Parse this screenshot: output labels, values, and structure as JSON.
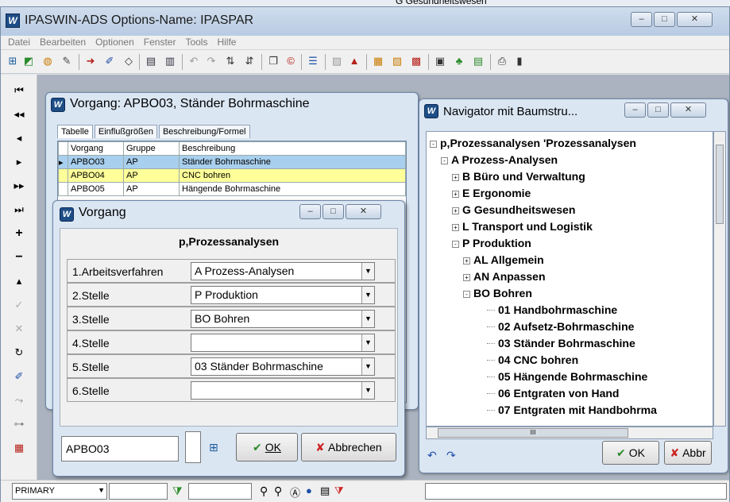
{
  "bg_title": "G Gesundheitswesen",
  "app": {
    "title": "IPASWIN-ADS   Options-Name: IPASPAR",
    "menu": [
      "Datei",
      "Bearbeiten",
      "Optionen",
      "Fenster",
      "Tools",
      "Hilfe"
    ],
    "minimize": "–",
    "maximize": "□",
    "close": "✕"
  },
  "vorgang_window": {
    "title": "Vorgang: APBO03, Ständer Bohrmaschine",
    "tabs": [
      "Tabelle",
      "Einflußgrößen",
      "Beschreibung/Formel"
    ],
    "columns": [
      "Vorgang",
      "Gruppe",
      "Beschreibung"
    ],
    "rows": [
      {
        "vorgang": "APBO03",
        "gruppe": "AP",
        "beschreibung": "Ständer Bohrmaschine"
      },
      {
        "vorgang": "APBO04",
        "gruppe": "AP",
        "beschreibung": "CNC bohren"
      },
      {
        "vorgang": "APBO05",
        "gruppe": "AP",
        "beschreibung": "Hängende Bohrmaschine"
      }
    ]
  },
  "dialog": {
    "title": "Vorgang",
    "heading": "p,Prozessanalysen",
    "fields": [
      {
        "label": "1.Arbeitsverfahren",
        "value": "A Prozess-Analysen"
      },
      {
        "label": "2.Stelle",
        "value": "P Produktion"
      },
      {
        "label": "3.Stelle",
        "value": "BO Bohren"
      },
      {
        "label": "4.Stelle",
        "value": ""
      },
      {
        "label": "5.Stelle",
        "value": "03 Ständer Bohrmaschine"
      },
      {
        "label": "6.Stelle",
        "value": ""
      }
    ],
    "code": "APBO03",
    "ok_label": "OK",
    "cancel_label": "Abbrechen"
  },
  "navigator": {
    "title": "Navigator mit Baumstru...",
    "nodes": [
      {
        "text": "p,Prozessanalysen 'Prozessanalysen",
        "level": 0,
        "sign": "-"
      },
      {
        "text": "A Prozess-Analysen",
        "level": 1,
        "sign": "-"
      },
      {
        "text": "B Büro und Verwaltung",
        "level": 2,
        "sign": "+"
      },
      {
        "text": "E Ergonomie",
        "level": 2,
        "sign": "+"
      },
      {
        "text": "G Gesundheitswesen",
        "level": 2,
        "sign": "+"
      },
      {
        "text": "L Transport und Logistik",
        "level": 2,
        "sign": "+"
      },
      {
        "text": "P Produktion",
        "level": 2,
        "sign": "-"
      },
      {
        "text": "AL Allgemein",
        "level": 3,
        "sign": "+"
      },
      {
        "text": "AN Anpassen",
        "level": 3,
        "sign": "+"
      },
      {
        "text": "BO Bohren",
        "level": 3,
        "sign": "-"
      },
      {
        "text": "01 Handbohrmaschine",
        "level": 4,
        "sign": ""
      },
      {
        "text": "02 Aufsetz-Bohrmaschine",
        "level": 4,
        "sign": ""
      },
      {
        "text": "03 Ständer Bohrmaschine",
        "level": 4,
        "sign": ""
      },
      {
        "text": "04 CNC bohren",
        "level": 4,
        "sign": ""
      },
      {
        "text": "05 Hängende Bohrmaschine",
        "level": 4,
        "sign": ""
      },
      {
        "text": "06 Entgraten von Hand",
        "level": 4,
        "sign": ""
      },
      {
        "text": "07 Entgraten mit Handbohrma",
        "level": 4,
        "sign": ""
      }
    ],
    "ok_label": "OK",
    "cancel_label": "Abbr",
    "hscroll_thumb": "III"
  },
  "statusbar": {
    "db_value": "PRIMARY"
  }
}
